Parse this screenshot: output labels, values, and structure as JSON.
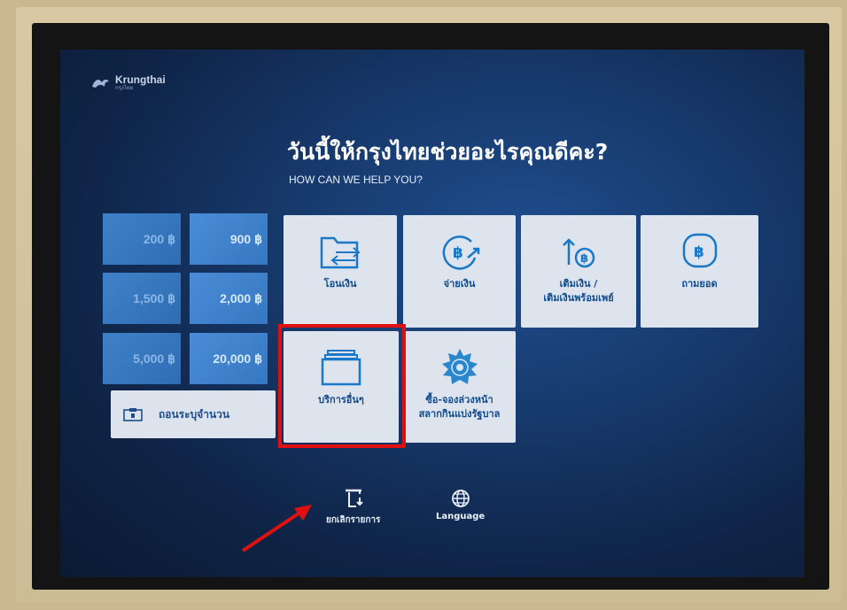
{
  "brand": {
    "name": "Krungthai",
    "sub": "กรุงไทย"
  },
  "header": {
    "title": "วันนี้ให้กรุงไทยช่วยอะไรคุณดีคะ?",
    "subtitle": "HOW CAN WE HELP YOU?"
  },
  "quick_amounts": [
    {
      "label": "200 ฿"
    },
    {
      "label": "900 ฿"
    },
    {
      "label": "1,500 ฿"
    },
    {
      "label": "2,000 ฿"
    },
    {
      "label": "5,000 ฿"
    },
    {
      "label": "20,000 ฿"
    }
  ],
  "custom_withdraw": {
    "label": "ถอนระบุจำนวน"
  },
  "services": [
    {
      "label": "โอนเงิน",
      "icon": "transfer-icon"
    },
    {
      "label": "จ่ายเงิน",
      "icon": "pay-icon"
    },
    {
      "label": "เติมเงิน /",
      "label2": "เติมเงินพร้อมเพย์",
      "icon": "topup-icon"
    },
    {
      "label": "ถามยอด",
      "icon": "balance-icon"
    },
    {
      "label": "บริการอื่นๆ",
      "icon": "other-services-icon"
    },
    {
      "label": "ซื้อ-จองล่วงหน้า",
      "label2": "สลากกินแบ่งรัฐบาล",
      "icon": "lottery-icon"
    }
  ],
  "footer": {
    "cancel": "ยกเลิกรายการ",
    "language": "Language"
  },
  "colors": {
    "screen_bg": "#173a6d",
    "tile_bg": "#dde4ed",
    "tile_text": "#0f4a8c",
    "highlight": "#e01010"
  }
}
